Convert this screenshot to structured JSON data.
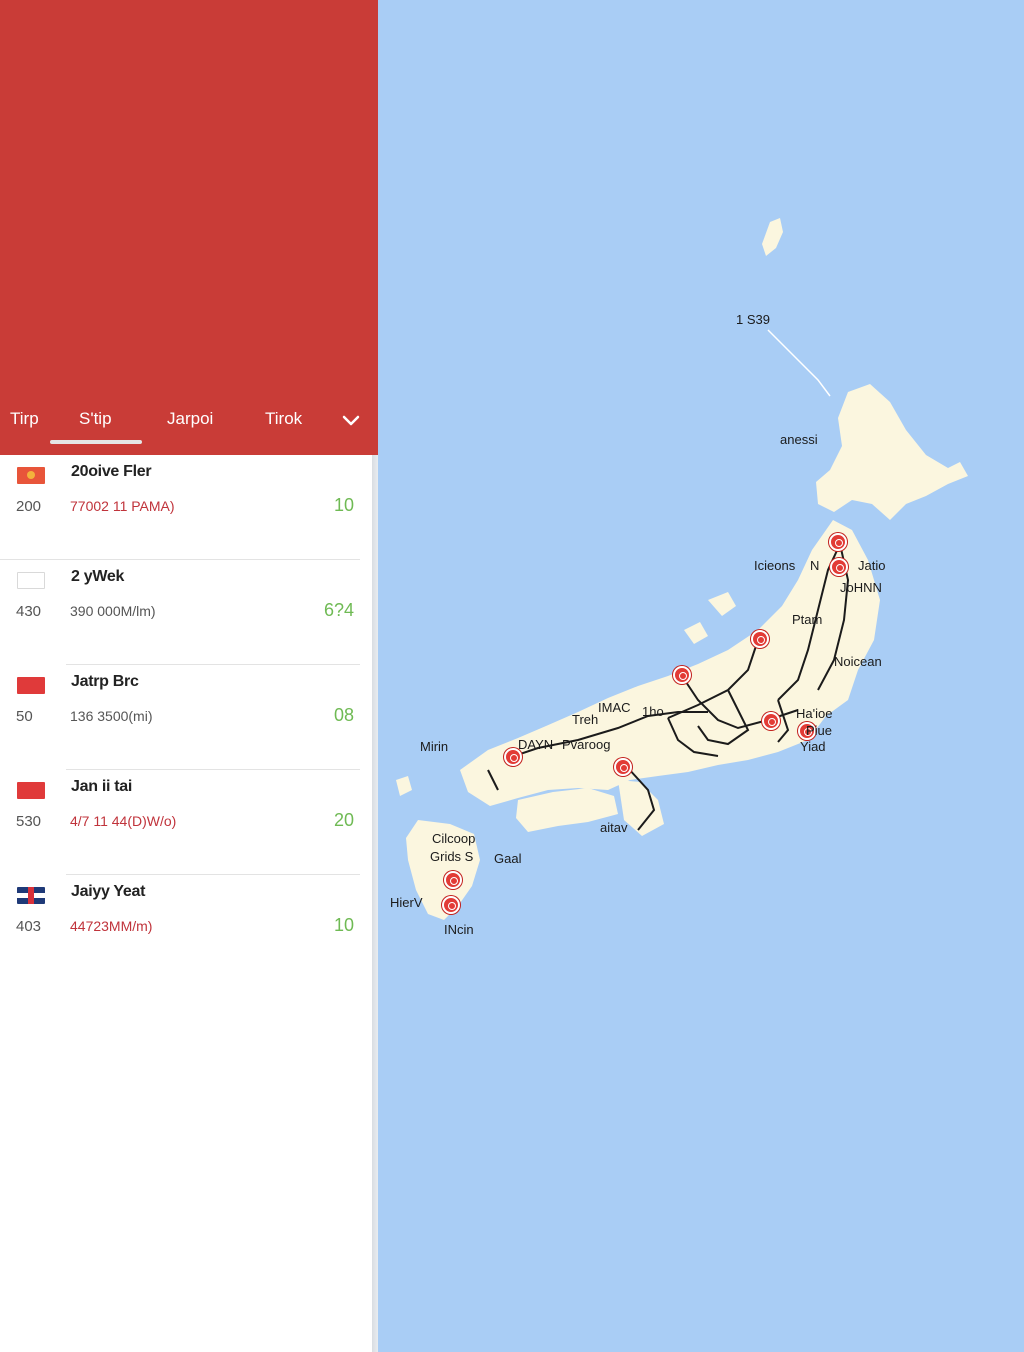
{
  "tabs": [
    {
      "label": "Tirp"
    },
    {
      "label": "S'tip"
    },
    {
      "label": "Jarpoi"
    },
    {
      "label": "Tirok"
    }
  ],
  "rows": [
    {
      "flag": "orange",
      "title": "20oive Fler",
      "left": "200",
      "sub": "77002 11 PAMA)",
      "sub_color": "red",
      "value": "10"
    },
    {
      "flag": "white",
      "title": "2 yWek",
      "left": "430",
      "sub": "390 000M/lm)",
      "sub_color": "normal",
      "value": "6?4"
    },
    {
      "flag": "red",
      "title": "Jatrp Brc",
      "left": "50",
      "sub": "136 3500(mi)",
      "sub_color": "normal",
      "value": "08"
    },
    {
      "flag": "red",
      "title": "Jan ii tai",
      "left": "530",
      "sub": "4/7 11 44(D)W/o)",
      "sub_color": "red",
      "value": "20"
    },
    {
      "flag": "uk",
      "title": "Jaiyy Yeat",
      "left": "403",
      "sub": "44723MM/m)",
      "sub_color": "red",
      "value": "10"
    }
  ],
  "map": {
    "labels": [
      {
        "text": "1 S39"
      },
      {
        "text": "anessi"
      },
      {
        "text": "Icieons"
      },
      {
        "text": "N"
      },
      {
        "text": "Jatio"
      },
      {
        "text": "JoHNN"
      },
      {
        "text": "Ptam"
      },
      {
        "text": "Noicean"
      },
      {
        "text": "IMAC"
      },
      {
        "text": "Treh"
      },
      {
        "text": "1ho"
      },
      {
        "text": "DAYN"
      },
      {
        "text": "Pvaroog"
      },
      {
        "text": "Ha'ioe"
      },
      {
        "text": "Piue"
      },
      {
        "text": "Yiad"
      },
      {
        "text": "Mirin"
      },
      {
        "text": "Cilcoop"
      },
      {
        "text": "Grids S"
      },
      {
        "text": "Gaal"
      },
      {
        "text": "aitav"
      },
      {
        "text": "HierV"
      },
      {
        "text": "INcin"
      }
    ],
    "colors": {
      "sea": "#a9cdf5",
      "land": "#fbf6df",
      "pin": "#e23b36",
      "header": "#c93c37"
    }
  }
}
